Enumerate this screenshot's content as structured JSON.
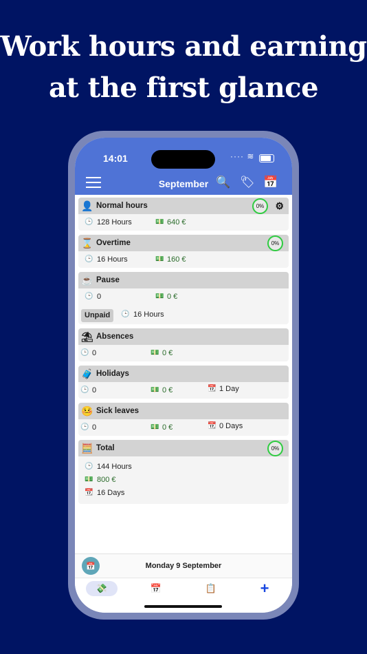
{
  "headline": {
    "line1": "Work hours and earning",
    "line2": "at the first glance"
  },
  "status": {
    "time": "14:01",
    "signal": "····",
    "wifi": "≋"
  },
  "appbar": {
    "month": "September",
    "icons": [
      "hamburger-menu-icon",
      "search-icon",
      "tag-icon",
      "calendar-icon"
    ]
  },
  "cards": {
    "normal": {
      "title": "Normal hours",
      "pct": "0%",
      "hours": "128 Hours",
      "money": "640 €"
    },
    "overtime": {
      "title": "Overtime",
      "pct": "0%",
      "hours": "16 Hours",
      "money": "160 €"
    },
    "pause": {
      "title": "Pause",
      "hours": "0",
      "money": "0 €",
      "unpaid_label": "Unpaid",
      "unpaid_hours": "16 Hours"
    },
    "absences": {
      "title": "Absences",
      "hours": "0",
      "money": "0 €"
    },
    "holidays": {
      "title": "Holidays",
      "hours": "0",
      "money": "0 €",
      "days": "1 Day"
    },
    "sick": {
      "title": "Sick leaves",
      "hours": "0",
      "money": "0 €",
      "days": "0 Days"
    },
    "total": {
      "title": "Total",
      "pct": "0%",
      "hours": "144 Hours",
      "money": "800 €",
      "days": "16 Days"
    }
  },
  "datebar": {
    "date": "Monday 9 September"
  },
  "tabbar": {
    "plus": "+"
  },
  "colors": {
    "background": "#001463",
    "appbar": "#4f73d6",
    "progress_ring": "#2ecc40"
  }
}
